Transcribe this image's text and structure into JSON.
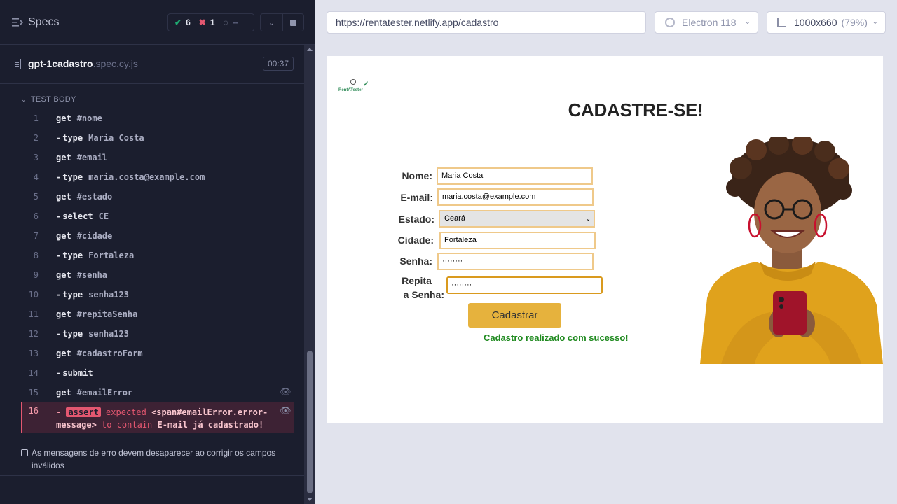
{
  "reporter": {
    "header": {
      "title": "Specs",
      "passed": "6",
      "failed": "1",
      "pending": "--"
    },
    "spec": {
      "name": "gpt-1cadastro",
      "ext": ".spec.cy.js",
      "duration": "00:37"
    },
    "test_body_label": "TEST BODY",
    "commands": [
      {
        "num": "1",
        "name": "get",
        "msg": "#nome",
        "child": false
      },
      {
        "num": "2",
        "name": "type",
        "msg": "Maria Costa",
        "child": true
      },
      {
        "num": "3",
        "name": "get",
        "msg": "#email",
        "child": false
      },
      {
        "num": "4",
        "name": "type",
        "msg": "maria.costa@example.com",
        "child": true
      },
      {
        "num": "5",
        "name": "get",
        "msg": "#estado",
        "child": false
      },
      {
        "num": "6",
        "name": "select",
        "msg": "CE",
        "child": true
      },
      {
        "num": "7",
        "name": "get",
        "msg": "#cidade",
        "child": false
      },
      {
        "num": "8",
        "name": "type",
        "msg": "Fortaleza",
        "child": true
      },
      {
        "num": "9",
        "name": "get",
        "msg": "#senha",
        "child": false
      },
      {
        "num": "10",
        "name": "type",
        "msg": "senha123",
        "child": true
      },
      {
        "num": "11",
        "name": "get",
        "msg": "#repitaSenha",
        "child": false
      },
      {
        "num": "12",
        "name": "type",
        "msg": "senha123",
        "child": true
      },
      {
        "num": "13",
        "name": "get",
        "msg": "#cadastroForm",
        "child": false
      },
      {
        "num": "14",
        "name": "submit",
        "msg": "",
        "child": true
      },
      {
        "num": "15",
        "name": "get",
        "msg": "#emailError",
        "child": false
      }
    ],
    "error_command": {
      "num": "16",
      "name": "assert",
      "kw_expected": "expected",
      "subject": "<span#emailError.error-message>",
      "kw_contain": "to contain",
      "value": "E-mail já cadastrado!"
    },
    "next_test": "As mensagens de erro devem desaparecer ao corrigir os campos inválidos"
  },
  "aut": {
    "url": "https://rentatester.netlify.app/cadastro",
    "browser": "Electron 118",
    "viewport": "1000x660",
    "zoom": "(79%)",
    "page": {
      "logo_text": "RentATester",
      "title": "CADASTRE-SE!",
      "form": {
        "nome_label": "Nome:",
        "nome_value": "Maria Costa",
        "email_label": "E-mail:",
        "email_value": "maria.costa@example.com",
        "estado_label": "Estado:",
        "estado_value": "Ceará",
        "cidade_label": "Cidade:",
        "cidade_value": "Fortaleza",
        "senha_label": "Senha:",
        "senha_value": "········",
        "repita_label_1": "Repita",
        "repita_label_2": "a Senha:",
        "repita_value": "········",
        "submit_label": "Cadastrar",
        "success_message": "Cadastro realizado com sucesso!"
      }
    }
  },
  "colors": {
    "passed": "#1fa971",
    "failed": "#e45770",
    "button": "#e6b23d",
    "success": "#1f8a1f",
    "sweater": "#e0a21c"
  }
}
